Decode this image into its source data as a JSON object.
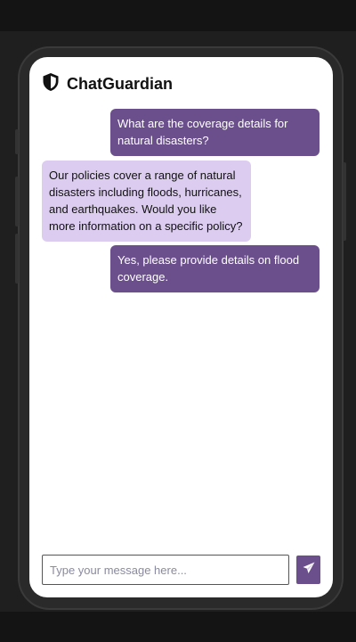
{
  "app": {
    "title": "ChatGuardian",
    "logo_icon": "shield-icon"
  },
  "messages": [
    {
      "role": "user",
      "text": "What are the coverage details for natural disasters?"
    },
    {
      "role": "bot",
      "text": "Our policies cover a range of natural disasters including floods, hurricanes, and earthquakes. Would you like more information on a specific policy?"
    },
    {
      "role": "user",
      "text": "Yes, please provide details on flood coverage."
    }
  ],
  "composer": {
    "placeholder": "Type your message here...",
    "value": "",
    "send_icon": "send-icon"
  },
  "colors": {
    "user_bubble": "#6b4f8c",
    "bot_bubble": "#dccdf0",
    "accent": "#6b4f8c"
  }
}
